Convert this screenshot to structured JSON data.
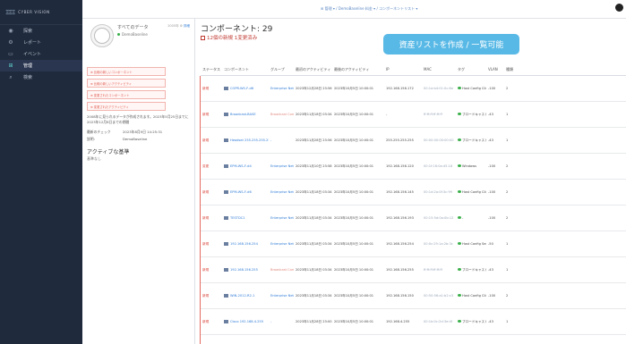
{
  "brand": {
    "logo": "ΞΞΞ",
    "name": "CYBER VISION"
  },
  "nav": [
    {
      "icon": "◉",
      "label": "探索"
    },
    {
      "icon": "⚙",
      "label": "レポート"
    },
    {
      "icon": "▭",
      "label": "イベント"
    },
    {
      "icon": "⊞",
      "label": "管理"
    },
    {
      "icon": "⌕",
      "label": "検索"
    }
  ],
  "topbar": {
    "breadcrumb": "⊞ 管理 ▾ / DemoBaseline 料金 ▾ / コンポーネントリスト ▾"
  },
  "left": {
    "source_title": "すべてのデータ",
    "source_sub": "DemoBaseline",
    "source_actions": {
      "muted": "2005年 ⚙",
      "action": "詳細"
    },
    "filters": [
      "⊕ 比較の新しいコンポーネント",
      "⊕ 比較の新しいアクティビティ",
      "⊕ 変更されたコンポーネント",
      "⊕ 変更されたアクティビティ"
    ],
    "note": "2008年に見られるデータが作成されます。2023年5月25日までに2023年12月8日までの期間",
    "meta": [
      {
        "k": "最新のチェック",
        "v": "2023年8月9日 14:25:31"
      },
      {
        "k": "説明:",
        "v": "DemoBaseline"
      }
    ],
    "active_label": "アクティブな基準",
    "active_sub": "基準なし"
  },
  "main": {
    "title": "コンポーネント: 29",
    "stats": "12個の新規  1変更済み",
    "banner": "資産リストを作成 / 一覧可能",
    "columns": [
      "ステータス",
      "コンポーネント",
      "グループ",
      "最初のアクティビティ",
      "最後のアクティビティ",
      "IP",
      "MAC",
      "タグ",
      "VLAN",
      "種類"
    ],
    "rows": [
      {
        "status": "新規",
        "device": "COPR-WS-F-d6",
        "group": "Enterprise Network",
        "first": "2023年12月28日 23:56:48",
        "last": "2023年10月5日 10:00:01",
        "ip": "192.168.156.172",
        "mac": "00:1e:b4:01:0c:6e",
        "tag": "Host Config Client, Windows",
        "vlan": "-100",
        "kind": "2"
      },
      {
        "status": "新規",
        "device": "Broadcast-BASE",
        "group": "Broadcast Components",
        "first": "2023年11月18日 03:34:15",
        "last": "2023年10月5日 10:00:01",
        "ip": "-",
        "mac": "ff:ff:ff:ff:ff:ff",
        "tag": "ブロードキャスト",
        "vlan": "-43",
        "kind": "1"
      },
      {
        "status": "新規",
        "device": "Headset 255.255.255.255",
        "group": "-",
        "first": "2023年11月28日 23:56:50",
        "last": "2023年10月5日 10:00:01",
        "ip": "255.255.255.255",
        "mac": "00:00:00:00:00:00",
        "tag": "ブロードキャスト",
        "vlan": "-43",
        "kind": "1"
      },
      {
        "status": "変更",
        "device": "EPM-WS-F-d4",
        "group": "Enterprise Network",
        "first": "2023年11月10日 23:58:30",
        "last": "2023年10月5日 10:00:01",
        "ip": "192.168.156.120",
        "mac": "00:1f:16:0a:45:18",
        "tag": "Windows",
        "vlan": "-100",
        "kind": "2"
      },
      {
        "status": "新規",
        "device": "EPM-WS-F-d6",
        "group": "Enterprise Network",
        "first": "2023年11月18日 03:34:15",
        "last": "2023年10月5日 10:00:01",
        "ip": "192.168.156.145",
        "mac": "00:1d:2a:0f:3c:99",
        "tag": "Host Config Client, Windows",
        "vlan": "-100",
        "kind": "2"
      },
      {
        "status": "新規",
        "device": "TESTDC1",
        "group": "Enterprise Network",
        "first": "2023年11月18日 03:34:15",
        "last": "2023年10月5日 10:00:01",
        "ip": "192.168.156.193",
        "mac": "00:15:5d:0a:0b:12",
        "tag": "-",
        "vlan": "-100",
        "kind": "2"
      },
      {
        "status": "新規",
        "device": "192.168.156.254",
        "group": "Enterprise Network",
        "first": "2023年11月18日 03:34:15",
        "last": "2023年10月5日 10:00:01",
        "ip": "192.168.156.254",
        "mac": "00:0c:29:1a:2b:3c",
        "tag": "Host Config Server",
        "vlan": "-50",
        "kind": "1"
      },
      {
        "status": "新規",
        "device": "192.168.156.255",
        "group": "Broadcast Components",
        "first": "2023年11月18日 03:34:15",
        "last": "2023年10月5日 10:00:01",
        "ip": "192.168.156.255",
        "mac": "ff:ff:ff:ff:ff:ff",
        "tag": "ブロードキャスト",
        "vlan": "-43",
        "kind": "1"
      },
      {
        "status": "新規",
        "device": "WIN-2012-R2-1",
        "group": "Enterprise Network",
        "first": "2023年11月18日 03:34:15",
        "last": "2023年10月5日 10:00:01",
        "ip": "192.168.156.150",
        "mac": "00:50:56:a1:b2:c3",
        "tag": "Host Config Client, Windows",
        "vlan": "-100",
        "kind": "2"
      },
      {
        "status": "新規",
        "device": "Cisco 192.168.4.255",
        "group": "-",
        "first": "2023年11月28日 23:00:01",
        "last": "2023年10月5日 10:00:01",
        "ip": "192.168.4.255",
        "mac": "00:1b:0c:2d:3e:4f",
        "tag": "ブロードキャスト",
        "vlan": "-43",
        "kind": "1"
      }
    ]
  },
  "colors": {
    "nav_bg": "#1f2a3c",
    "accent": "#5cc9c6",
    "status_new": "#d9473c",
    "banner": "#59b9e6"
  }
}
